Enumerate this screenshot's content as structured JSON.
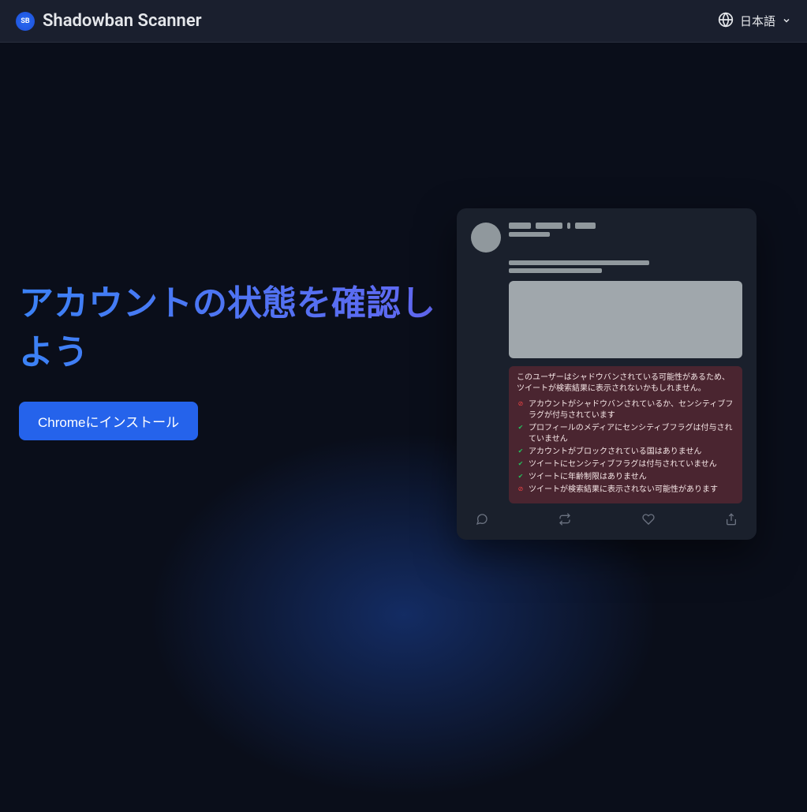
{
  "header": {
    "logo_text": "Shadowban Scanner",
    "language": "日本語"
  },
  "hero": {
    "title": "アカウントの状態を確認しよう",
    "install_button": "Chromeにインストール"
  },
  "status": {
    "warning": "このユーザーはシャドウバンされている可能性があるため、ツイートが検索結果に表示されないかもしれません。",
    "items": [
      {
        "icon": "red",
        "text": "アカウントがシャドウバンされているか、センシティブフラグが付与されています"
      },
      {
        "icon": "green",
        "text": "プロフィールのメディアにセンシティブフラグは付与されていません"
      },
      {
        "icon": "green",
        "text": "アカウントがブロックされている国はありません"
      },
      {
        "icon": "green",
        "text": "ツイートにセンシティブフラグは付与されていません"
      },
      {
        "icon": "green",
        "text": "ツイートに年齢制限はありません"
      },
      {
        "icon": "red",
        "text": "ツイートが検索結果に表示されない可能性があります"
      }
    ]
  }
}
